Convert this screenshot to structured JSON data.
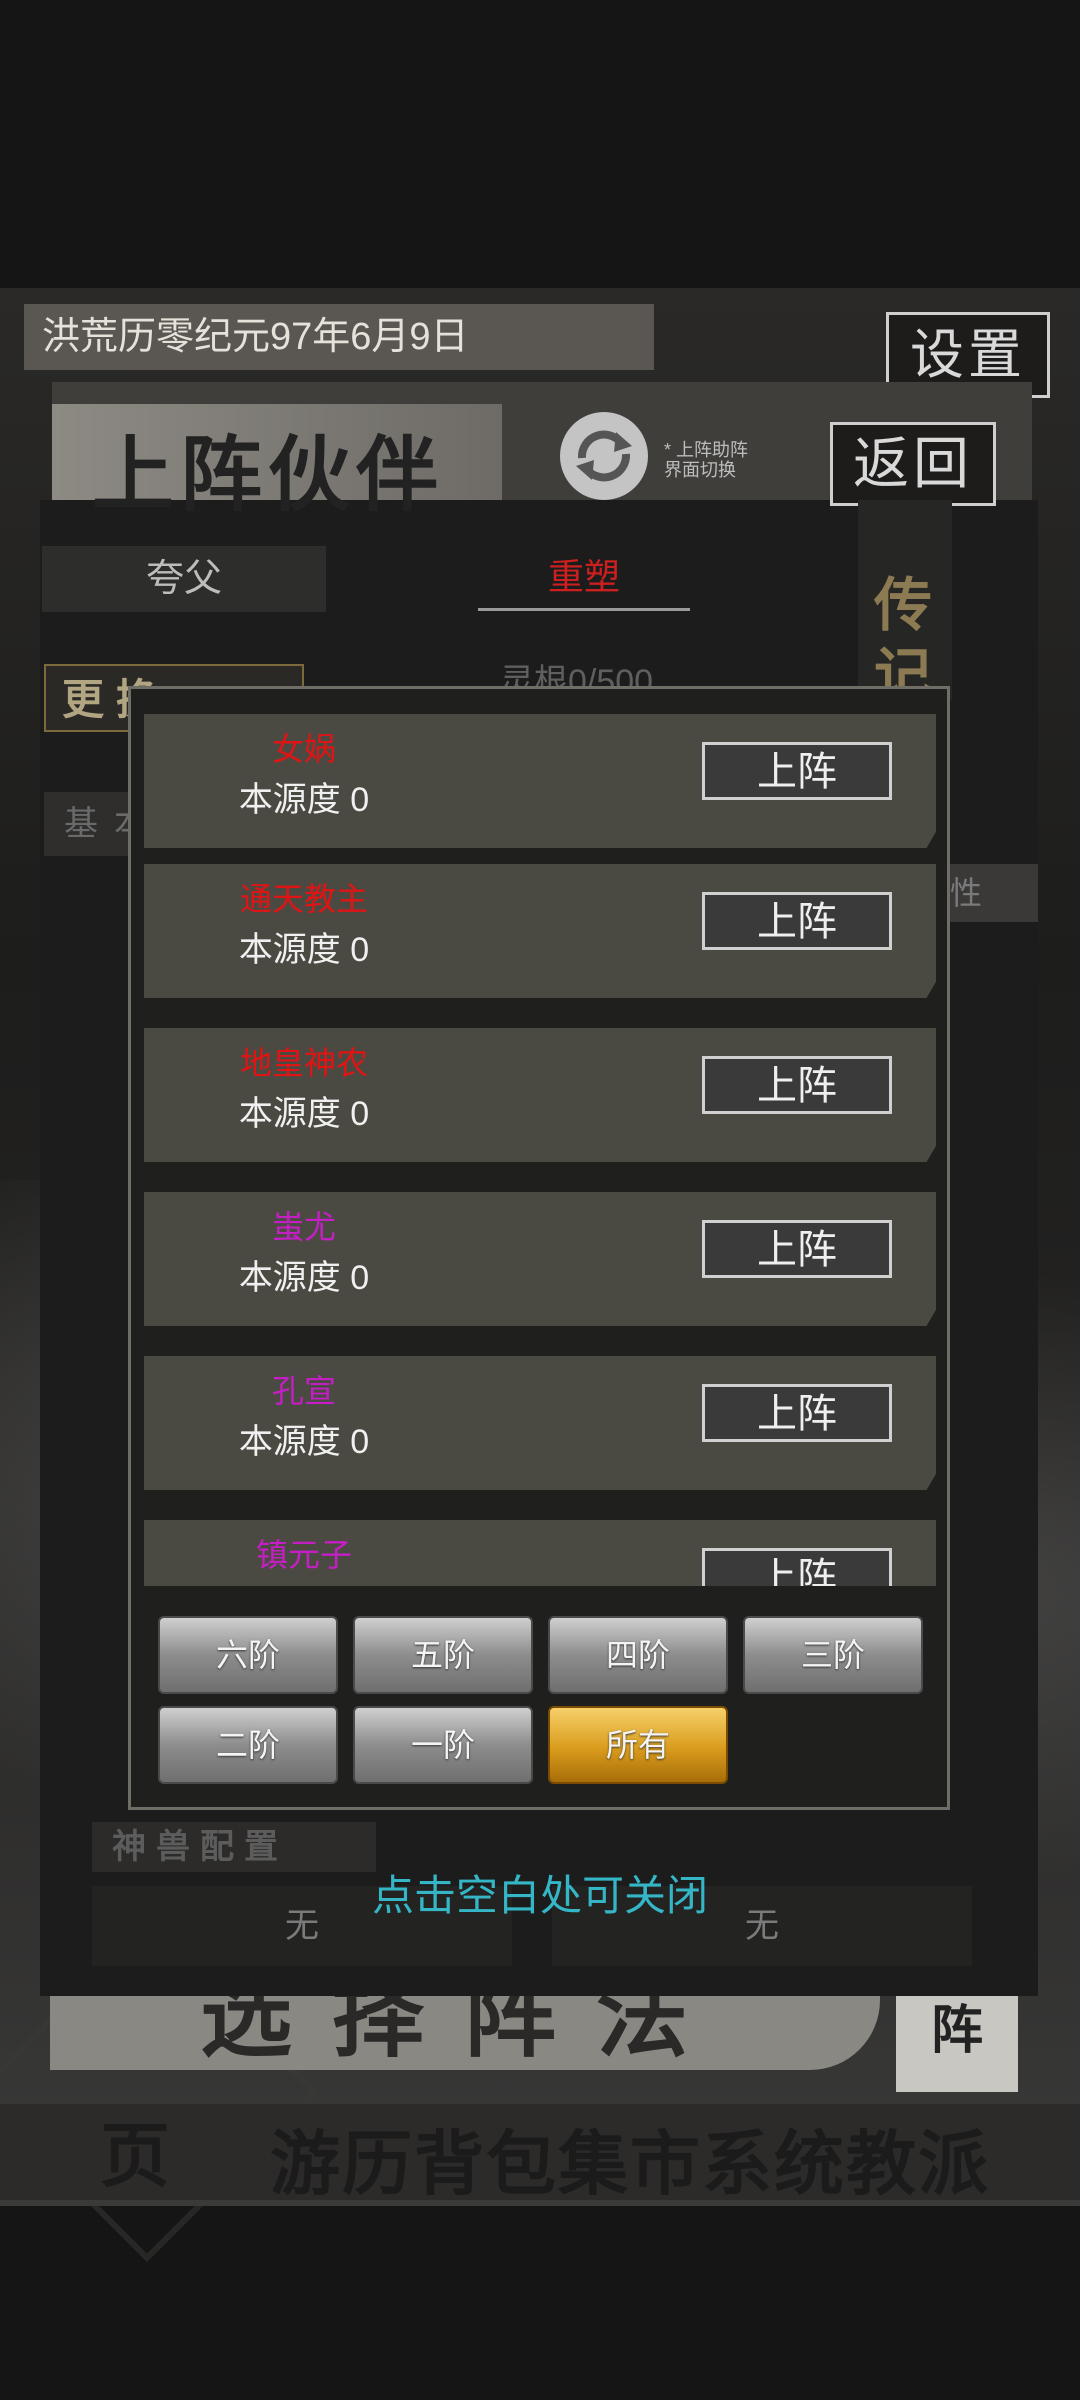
{
  "status_bar": {},
  "game": {
    "date": "洪荒历零纪元97年6月9日",
    "settings_label": "设置",
    "partner_title": "上阵伙伴",
    "swap_hint": "* 上阵助阵 界面切换",
    "return_label": "返回",
    "tabs": [
      {
        "label": "夸父",
        "active": false
      },
      {
        "label": "重塑",
        "active": true
      }
    ],
    "right_strip_label": "传记",
    "lingen_text": "灵根0/500",
    "change_button": "更换",
    "basic_label": "基本",
    "attr_label": "性",
    "beast_config_label": "神兽配置",
    "beast_slots": [
      "无",
      "无"
    ],
    "formation_banner": "选择阵法",
    "formation_right": "阵",
    "bottom_nav_text": "游历背包集市系统教派",
    "bottom_nav_left": "页"
  },
  "popup": {
    "partners": [
      {
        "name": "女娲",
        "name_color": "#e01414",
        "source_label": "本源度 0",
        "action": "上阵"
      },
      {
        "name": "通天教主",
        "name_color": "#e01414",
        "source_label": "本源度 0",
        "action": "上阵"
      },
      {
        "name": "地皇神农",
        "name_color": "#e01414",
        "source_label": "本源度 0",
        "action": "上阵"
      },
      {
        "name": "蚩尤",
        "name_color": "#c41ec4",
        "source_label": "本源度 0",
        "action": "上阵"
      },
      {
        "name": "孔宣",
        "name_color": "#c41ec4",
        "source_label": "本源度 0",
        "action": "上阵"
      },
      {
        "name": "镇元子",
        "name_color": "#c41ec4",
        "source_label": "",
        "action": "上阵"
      }
    ],
    "filters": [
      {
        "label": "六阶",
        "active": false
      },
      {
        "label": "五阶",
        "active": false
      },
      {
        "label": "四阶",
        "active": false
      },
      {
        "label": "三阶",
        "active": false
      },
      {
        "label": "二阶",
        "active": false
      },
      {
        "label": "一阶",
        "active": false
      },
      {
        "label": "所有",
        "active": true
      }
    ],
    "close_hint": "点击空白处可关闭"
  }
}
